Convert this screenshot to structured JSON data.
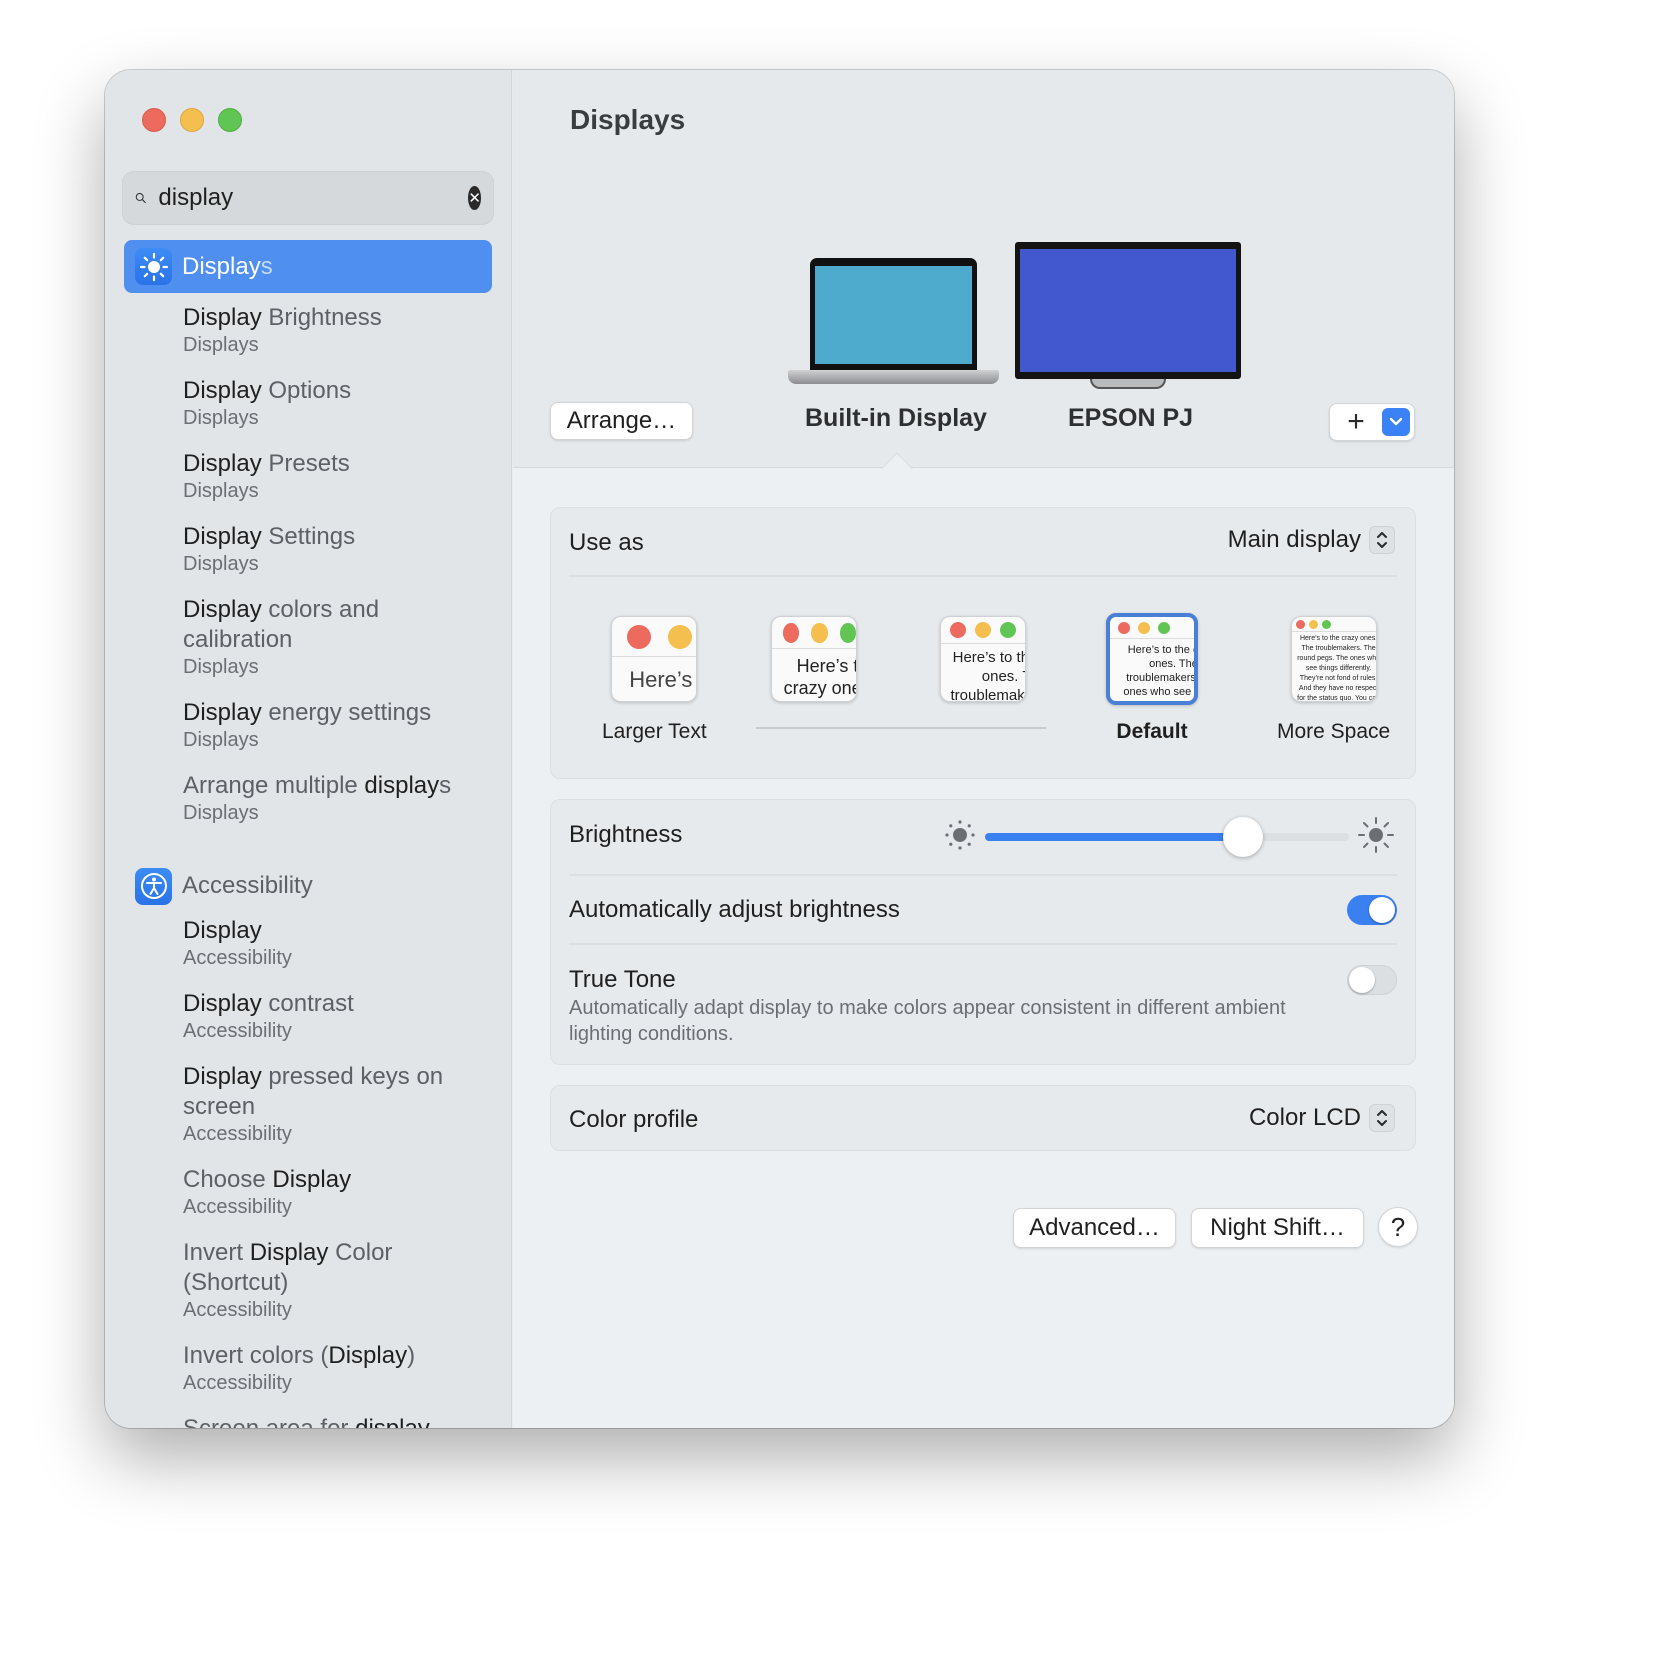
{
  "window": {
    "traffic_lights": [
      "close",
      "minimize",
      "maximize"
    ]
  },
  "sidebar": {
    "search": {
      "value": "display",
      "icon": "search-icon",
      "clear_icon": "clear-icon"
    },
    "selected": {
      "icon": "sun-icon",
      "label_match": "Display",
      "label_rest": "s"
    },
    "displays_results": [
      {
        "match": "Display",
        "rest": " Brightness",
        "category": "Displays"
      },
      {
        "match": "Display",
        "rest": " Options",
        "category": "Displays"
      },
      {
        "match": "Display",
        "rest": " Presets",
        "category": "Displays"
      },
      {
        "match": "Display",
        "rest": " Settings",
        "category": "Displays"
      },
      {
        "match": "Display",
        "rest": " colors and calibration",
        "category": "Displays"
      },
      {
        "match": "Display",
        "rest": " energy settings",
        "category": "Displays"
      },
      {
        "pre": "Arrange multiple ",
        "match": "display",
        "rest": "s",
        "category": "Displays"
      }
    ],
    "accessibility_header": {
      "icon": "accessibility-icon",
      "label": "Accessibility"
    },
    "accessibility_results": [
      {
        "match": "Display",
        "rest": "",
        "category": "Accessibility"
      },
      {
        "match": "Display",
        "rest": " contrast",
        "category": "Accessibility"
      },
      {
        "match": "Display",
        "rest": " pressed keys on screen",
        "category": "Accessibility"
      },
      {
        "pre": "Choose ",
        "match": "Display",
        "rest": "",
        "category": "Accessibility"
      },
      {
        "pre": "Invert ",
        "match": "Display",
        "rest": " Color (Shortcut)",
        "category": "Accessibility"
      },
      {
        "pre": "Invert colors (",
        "match": "Display",
        "rest": ")",
        "category": "Accessibility"
      },
      {
        "pre": "Screen area for ",
        "match": "display",
        "rest": "",
        "category": ""
      }
    ]
  },
  "main": {
    "title": "Displays",
    "arrange_button": "Arrange…",
    "displays": [
      {
        "name": "Built-in Display",
        "selected": true,
        "color": "#4eabcd"
      },
      {
        "name": "EPSON PJ",
        "selected": false,
        "color": "#4158cf"
      }
    ],
    "add_button": "+",
    "use_as": {
      "label": "Use as",
      "value": "Main display"
    },
    "resolution": {
      "options": [
        {
          "label": "Larger Text",
          "preview": "Here’s"
        },
        {
          "label": "",
          "preview": "Here’s to the crazy ones. The troublemakers."
        },
        {
          "label": "",
          "preview": "Here’s to the crazy ones. The troublemakers. The ones who"
        },
        {
          "label": "Default",
          "preview": "Here’s to the crazy ones. The troublemakers. The ones who see things differently. They’re not fond of rules. And they",
          "selected": true
        },
        {
          "label": "More Space",
          "preview": "Here’s to the crazy ones. The troublemakers. The round pegs. The ones who see things differently. They’re not fond of rules. And they have no respect for the status quo. You can quote them, disagree with them. About the only thing you can't do is ignore them. Because they change things."
        }
      ]
    },
    "brightness": {
      "label": "Brightness",
      "value_percent": 71
    },
    "auto_brightness": {
      "label": "Automatically adjust brightness",
      "on": true
    },
    "true_tone": {
      "label": "True Tone",
      "description": "Automatically adapt display to make colors appear consistent in different ambient lighting conditions.",
      "on": false
    },
    "color_profile": {
      "label": "Color profile",
      "value": "Color LCD"
    },
    "buttons": {
      "advanced": "Advanced…",
      "night_shift": "Night Shift…",
      "help": "?"
    }
  }
}
